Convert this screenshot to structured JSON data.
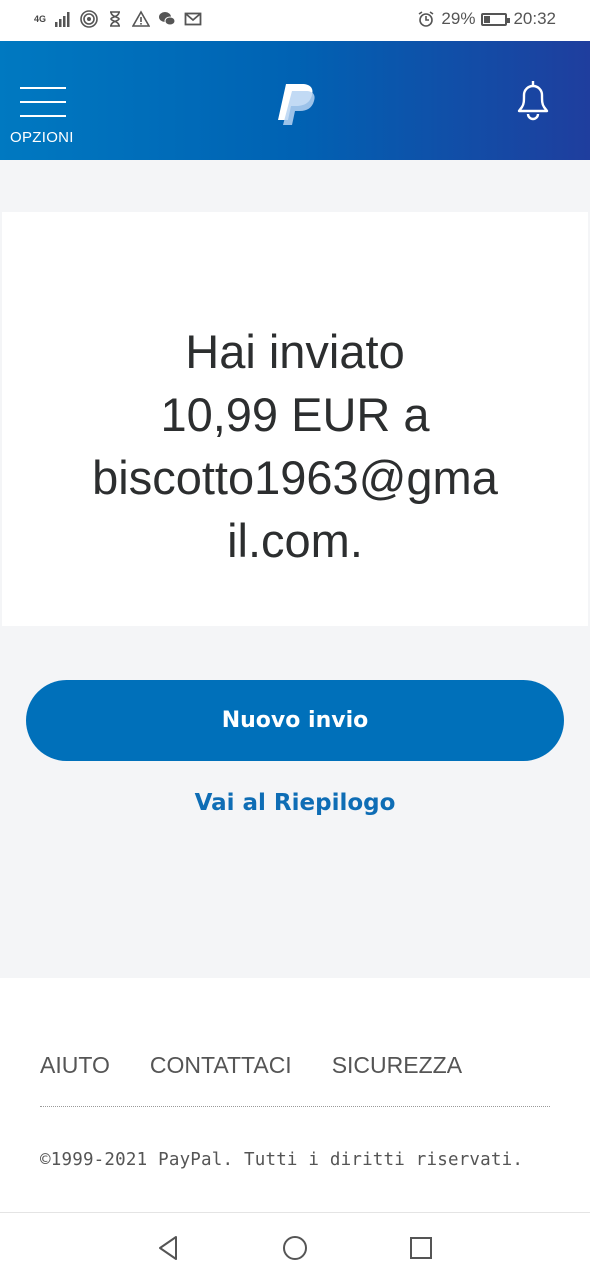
{
  "status_bar": {
    "network": "4G",
    "battery": "29%",
    "battery_level": 0.29,
    "time": "20:32",
    "icons": [
      "signal-icon",
      "hotspot-icon",
      "hourglass-icon",
      "warning-icon",
      "wechat-icon",
      "mail-icon",
      "alarm-icon",
      "battery-icon"
    ]
  },
  "header": {
    "menu_label": "OPZIONI",
    "icons": [
      "menu-icon",
      "paypal-logo",
      "bell-icon"
    ],
    "colors": {
      "start": "#0079c1",
      "end": "#1f3e9e"
    }
  },
  "confirmation": {
    "line1": "Hai inviato",
    "line2": "10,99 EUR a",
    "line3": "biscotto1963@gma",
    "line4": "il.com."
  },
  "actions": {
    "primary_label": "Nuovo invio",
    "link_label": "Vai al Riepilogo",
    "accent_color": "#0070ba"
  },
  "footer": {
    "links": [
      "AIUTO",
      "CONTATTACI",
      "SICUREZZA"
    ],
    "copyright": "©1999-2021 PayPal. Tutti i diritti riservati."
  },
  "nav": {
    "icons": [
      "back-icon",
      "home-icon",
      "recent-apps-icon"
    ]
  }
}
